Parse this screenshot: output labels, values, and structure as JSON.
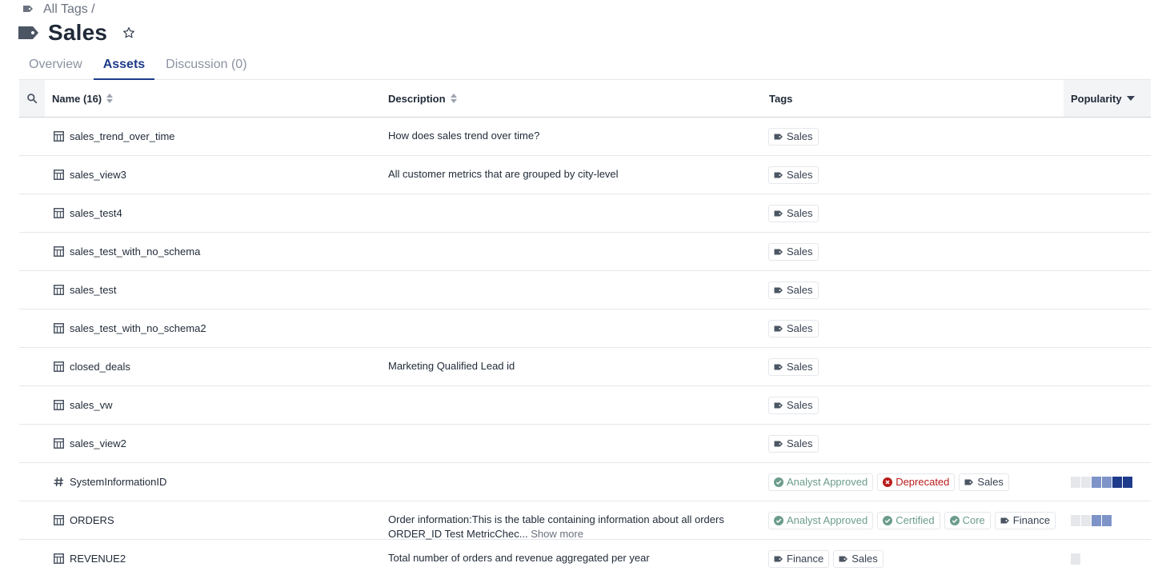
{
  "breadcrumb": {
    "link": "All Tags /"
  },
  "page": {
    "title": "Sales"
  },
  "tabs": [
    {
      "label": "Overview",
      "active": false
    },
    {
      "label": "Assets",
      "active": true
    },
    {
      "label": "Discussion (0)",
      "active": false
    }
  ],
  "table": {
    "headers": {
      "name": "Name (16)",
      "description": "Description",
      "tags": "Tags",
      "popularity": "Popularity"
    },
    "rows": [
      {
        "icon": "table-icon",
        "name": "sales_trend_over_time",
        "description": "How does sales trend over time?",
        "show_more": "",
        "tags": [
          {
            "label": "Sales",
            "kind": "tag"
          }
        ],
        "more": "",
        "popularity": 0
      },
      {
        "icon": "table-icon",
        "name": "sales_view3",
        "description": "All customer metrics that are grouped by city-level",
        "show_more": "",
        "tags": [
          {
            "label": "Sales",
            "kind": "tag"
          }
        ],
        "more": "",
        "popularity": 0
      },
      {
        "icon": "table-icon",
        "name": "sales_test4",
        "description": "",
        "show_more": "",
        "tags": [
          {
            "label": "Sales",
            "kind": "tag"
          }
        ],
        "more": "",
        "popularity": 0
      },
      {
        "icon": "table-icon",
        "name": "sales_test_with_no_schema",
        "description": "",
        "show_more": "",
        "tags": [
          {
            "label": "Sales",
            "kind": "tag"
          }
        ],
        "more": "",
        "popularity": 0
      },
      {
        "icon": "table-icon",
        "name": "sales_test",
        "description": "",
        "show_more": "",
        "tags": [
          {
            "label": "Sales",
            "kind": "tag"
          }
        ],
        "more": "",
        "popularity": 0
      },
      {
        "icon": "table-icon",
        "name": "sales_test_with_no_schema2",
        "description": "",
        "show_more": "",
        "tags": [
          {
            "label": "Sales",
            "kind": "tag"
          }
        ],
        "more": "",
        "popularity": 0
      },
      {
        "icon": "table-icon",
        "name": "closed_deals",
        "description": "Marketing Qualified Lead id",
        "show_more": "",
        "tags": [
          {
            "label": "Sales",
            "kind": "tag"
          }
        ],
        "more": "",
        "popularity": 0
      },
      {
        "icon": "table-icon",
        "name": "sales_vw",
        "description": "",
        "show_more": "",
        "tags": [
          {
            "label": "Sales",
            "kind": "tag"
          }
        ],
        "more": "",
        "popularity": 0
      },
      {
        "icon": "table-icon",
        "name": "sales_view2",
        "description": "",
        "show_more": "",
        "tags": [
          {
            "label": "Sales",
            "kind": "tag"
          }
        ],
        "more": "",
        "popularity": 0
      },
      {
        "icon": "hash-icon",
        "name": "SystemInformationID",
        "description": "",
        "show_more": "",
        "tags": [
          {
            "label": "Analyst Approved",
            "kind": "approved"
          },
          {
            "label": "Deprecated",
            "kind": "deprecated"
          },
          {
            "label": "Sales",
            "kind": "tag"
          }
        ],
        "more": "",
        "popularity": 6
      },
      {
        "icon": "table-icon",
        "name": "ORDERS",
        "description": "Order information:This is the table containing information about all orders ORDER_ID Test MetricChec...",
        "show_more": "Show more",
        "tags": [
          {
            "label": "Analyst Approved",
            "kind": "approved"
          },
          {
            "label": "Certified",
            "kind": "approved"
          },
          {
            "label": "Core",
            "kind": "approved"
          },
          {
            "label": "Finance",
            "kind": "tag"
          }
        ],
        "more": "...",
        "popularity": 4
      },
      {
        "icon": "table-icon",
        "name": "REVENUE2",
        "description": "Total number of orders and revenue aggregated per year",
        "show_more": "",
        "tags": [
          {
            "label": "Finance",
            "kind": "tag"
          },
          {
            "label": "Sales",
            "kind": "tag"
          }
        ],
        "more": "",
        "popularity": 1
      }
    ]
  },
  "colors": {
    "accent": "#1e3a8a",
    "approved": "#6b9c8c",
    "deprecated": "#b91c1c",
    "bar_light": "#e5e7eb",
    "bar_mid": "#7e93c8",
    "bar_dark": "#1e3a8a"
  }
}
